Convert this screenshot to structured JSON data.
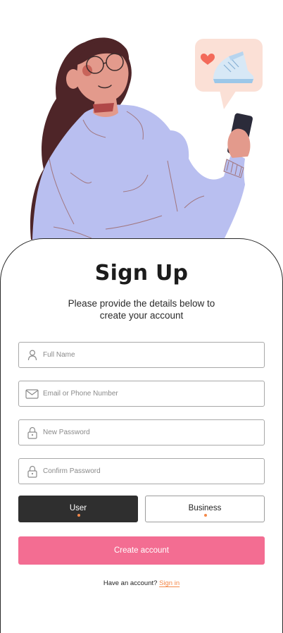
{
  "header": {
    "title": "Sign Up",
    "subtitle_line1": "Please provide the details below to",
    "subtitle_line2": "create your account"
  },
  "form": {
    "full_name": {
      "placeholder": "Full Name",
      "value": "",
      "icon": "user-icon"
    },
    "email_phone": {
      "placeholder": "Email or Phone Number",
      "value": "",
      "icon": "mail-icon"
    },
    "new_password": {
      "placeholder": "New Password",
      "value": "",
      "icon": "lock-icon"
    },
    "confirm_password": {
      "placeholder": "Confirm Password",
      "value": "",
      "icon": "lock-icon"
    }
  },
  "roles": {
    "selected": "User",
    "options": [
      {
        "label": "User",
        "selected": true
      },
      {
        "label": "Business",
        "selected": false
      }
    ]
  },
  "actions": {
    "create_account": "Create account",
    "have_account_text": "Have an account?",
    "sign_in_link": "Sign in"
  },
  "colors": {
    "primary_button": "#f36d92",
    "accent_orange": "#f4894a",
    "selected_role_bg": "#2f2f2f",
    "sweater": "#b9bff0",
    "hair": "#4e2528",
    "skin": "#e39a8c",
    "bubble_bg": "#fbe0d6"
  }
}
